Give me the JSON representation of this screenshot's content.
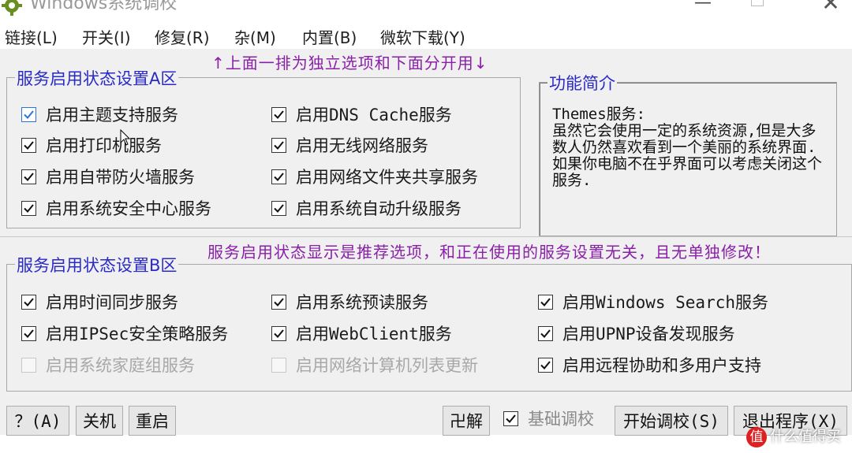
{
  "window": {
    "title": "Windows系统调校",
    "close_glyph": "✕",
    "minimize_glyph": "—"
  },
  "menu": [
    {
      "label": "链接(L)"
    },
    {
      "label": "开关(I)"
    },
    {
      "label": "修复(R)"
    },
    {
      "label": "杂(M)"
    },
    {
      "label": "内置(B)"
    },
    {
      "label": "微软下载(Y)"
    }
  ],
  "annotations": {
    "top": "↑上面一排为独立选项和下面分开用↓",
    "middle": "服务启用状态显示是推荐选项，和正在使用的服务设置无关，且无单独修改！"
  },
  "group_a": {
    "title": "服务启用状态设置A区",
    "items": [
      {
        "label": "启用主题支持服务",
        "checked": true,
        "disabled": false
      },
      {
        "label": "启用打印机服务",
        "checked": true,
        "disabled": false
      },
      {
        "label": "启用自带防火墙服务",
        "checked": true,
        "disabled": false
      },
      {
        "label": "启用系统安全中心服务",
        "checked": true,
        "disabled": false
      },
      {
        "label": "启用DNS Cache服务",
        "checked": true,
        "disabled": false
      },
      {
        "label": "启用无线网络服务",
        "checked": true,
        "disabled": false
      },
      {
        "label": "启用网络文件夹共享服务",
        "checked": true,
        "disabled": false
      },
      {
        "label": "启用系统自动升级服务",
        "checked": true,
        "disabled": false
      }
    ]
  },
  "description": {
    "title": "功能简介",
    "text": "Themes服务:\n虽然它会使用一定的系统资源,但是大多数人仍然喜欢看到一个美丽的系统界面.如果你电脑不在乎界面可以考虑关闭这个服务."
  },
  "group_b": {
    "title": "服务启用状态设置B区",
    "items": [
      {
        "label": "启用时间同步服务",
        "checked": true,
        "disabled": false
      },
      {
        "label": "启用IPSec安全策略服务",
        "checked": true,
        "disabled": false
      },
      {
        "label": "启用系统家庭组服务",
        "checked": false,
        "disabled": true
      },
      {
        "label": "启用系统预读服务",
        "checked": true,
        "disabled": false
      },
      {
        "label": "启用WebClient服务",
        "checked": true,
        "disabled": false
      },
      {
        "label": "启用网络计算机列表更新",
        "checked": false,
        "disabled": true
      },
      {
        "label": "启用Windows Search服务",
        "checked": true,
        "disabled": false
      },
      {
        "label": "启用UPNP设备发现服务",
        "checked": true,
        "disabled": false
      },
      {
        "label": "启用远程协助和多用户支持",
        "checked": true,
        "disabled": false
      }
    ]
  },
  "buttons": {
    "help": "？(A)",
    "shutdown": "关机",
    "restart": "重启",
    "uninstall": "卍解",
    "basic_tune": "基础调校",
    "basic_tune_checked": true,
    "start_tune": "开始调校(S)",
    "exit": "退出程序(X)"
  },
  "watermark": {
    "badge": "值",
    "text": "什么值得买"
  },
  "colors": {
    "legend_blue": "#2a2ac8",
    "annotation_purple": "#8a1fa8",
    "dialog_bg": "#f0f0f0",
    "disabled_text": "#a8a8a8"
  }
}
